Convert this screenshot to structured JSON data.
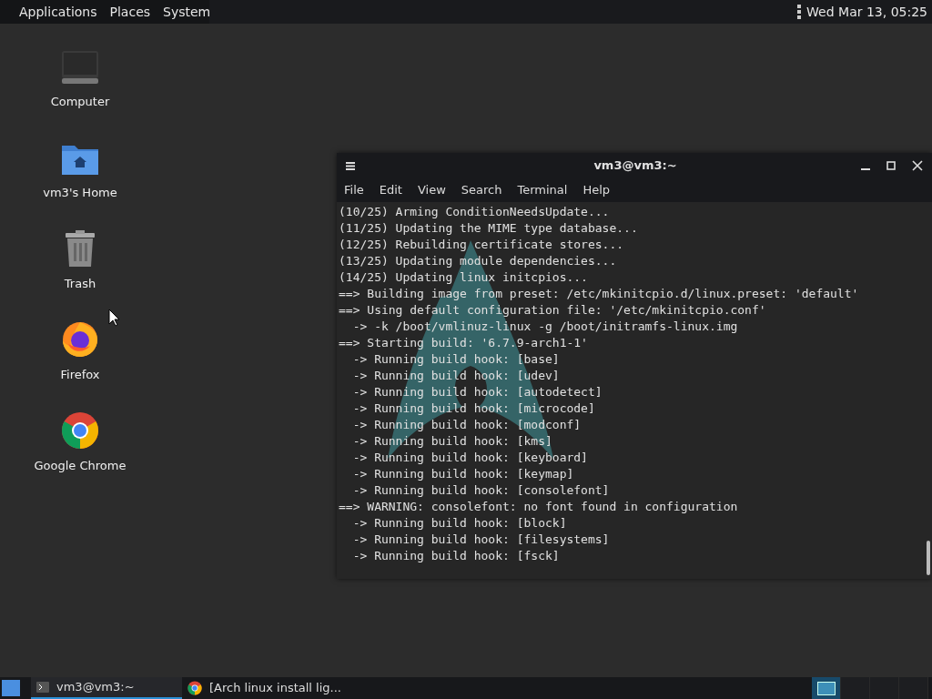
{
  "top_panel": {
    "menus": [
      "Applications",
      "Places",
      "System"
    ],
    "clock": "Wed Mar 13, 05:25"
  },
  "desktop_icons": [
    {
      "kind": "computer",
      "label": "Computer"
    },
    {
      "kind": "home",
      "label": "vm3's Home"
    },
    {
      "kind": "trash",
      "label": "Trash"
    },
    {
      "kind": "firefox",
      "label": "Firefox"
    },
    {
      "kind": "chrome",
      "label": "Google Chrome"
    }
  ],
  "terminal": {
    "title": "vm3@vm3:~",
    "menu": [
      "File",
      "Edit",
      "View",
      "Search",
      "Terminal",
      "Help"
    ],
    "lines": [
      "(10/25) Arming ConditionNeedsUpdate...",
      "(11/25) Updating the MIME type database...",
      "(12/25) Rebuilding certificate stores...",
      "(13/25) Updating module dependencies...",
      "(14/25) Updating linux initcpios...",
      "==> Building image from preset: /etc/mkinitcpio.d/linux.preset: 'default'",
      "==> Using default configuration file: '/etc/mkinitcpio.conf'",
      "  -> -k /boot/vmlinuz-linux -g /boot/initramfs-linux.img",
      "==> Starting build: '6.7.9-arch1-1'",
      "  -> Running build hook: [base]",
      "  -> Running build hook: [udev]",
      "  -> Running build hook: [autodetect]",
      "  -> Running build hook: [microcode]",
      "  -> Running build hook: [modconf]",
      "  -> Running build hook: [kms]",
      "  -> Running build hook: [keyboard]",
      "  -> Running build hook: [keymap]",
      "  -> Running build hook: [consolefont]",
      "==> WARNING: consolefont: no font found in configuration",
      "  -> Running build hook: [block]",
      "  -> Running build hook: [filesystems]",
      "  -> Running build hook: [fsck]"
    ]
  },
  "taskbar": {
    "tasks": [
      {
        "kind": "terminal",
        "label": "vm3@vm3:~",
        "selected": true
      },
      {
        "kind": "chrome",
        "label": "[Arch linux install lig...",
        "selected": false
      }
    ],
    "workspaces": [
      {
        "selected": true
      },
      {
        "selected": false
      },
      {
        "selected": false
      },
      {
        "selected": false
      }
    ]
  }
}
